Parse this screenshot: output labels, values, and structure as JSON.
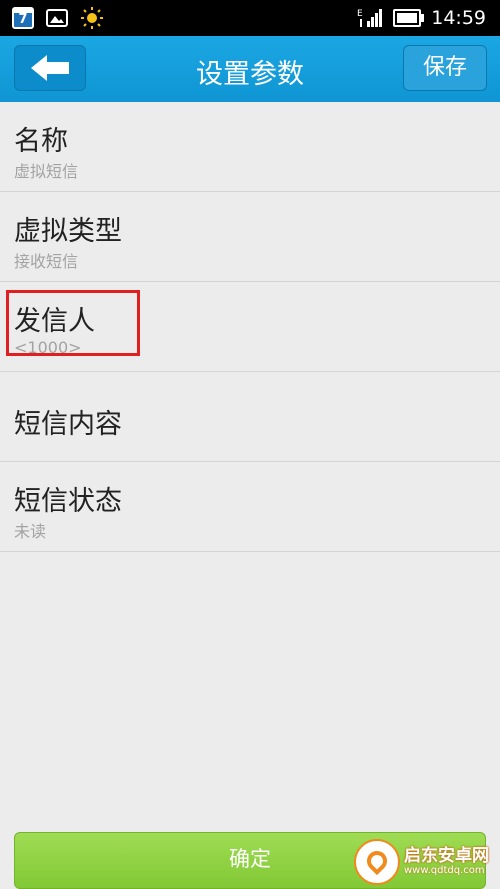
{
  "status_bar": {
    "calendar_day": "7",
    "time": "14:59",
    "network_type": "E",
    "icons": [
      "calendar-icon",
      "image-icon",
      "sun-icon",
      "signal-icon",
      "battery-icon"
    ]
  },
  "header": {
    "title": "设置参数",
    "save_label": "保存",
    "back_icon": "back-arrow-icon"
  },
  "settings": {
    "items": [
      {
        "label": "名称",
        "value": "虚拟短信"
      },
      {
        "label": "虚拟类型",
        "value": "接收短信"
      },
      {
        "label": "发信人",
        "value": "<1000>"
      },
      {
        "label": "短信内容",
        "value": ""
      },
      {
        "label": "短信状态",
        "value": "未读"
      }
    ]
  },
  "footer": {
    "confirm_label": "确定"
  },
  "watermark": {
    "name": "启东安卓网",
    "url": "www.qdtdq.com"
  },
  "colors": {
    "header": "#1ba7e3",
    "confirm": "#8fd244",
    "highlight": "#e02020"
  }
}
